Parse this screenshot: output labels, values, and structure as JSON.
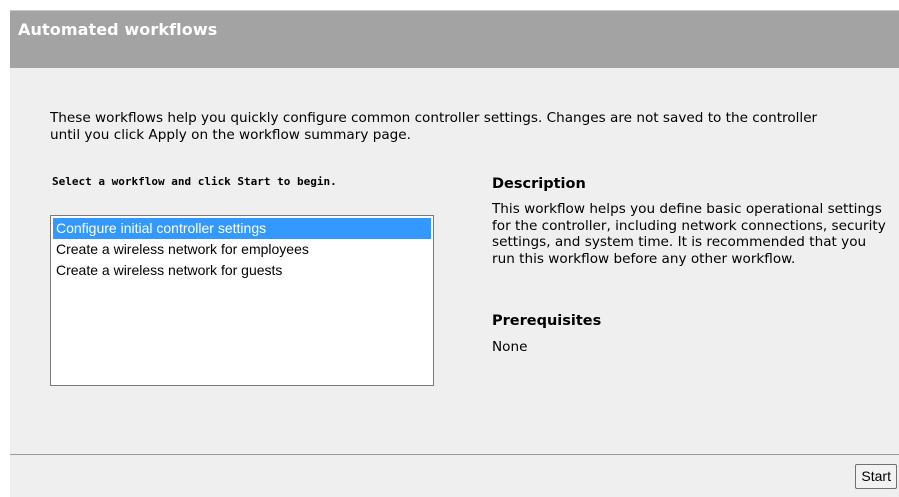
{
  "window": {
    "title": "Automated workflows"
  },
  "intro": {
    "text": "These workflows help you quickly configure common controller settings. Changes are not saved to the controller until you click Apply on the workflow summary page."
  },
  "workflow_list": {
    "label": "Select a workflow and click Start to begin.",
    "items": [
      "Configure initial controller settings",
      "Create a wireless network for employees",
      "Create a wireless network for guests"
    ],
    "selected": "Configure initial controller settings"
  },
  "description": {
    "heading": "Description",
    "text": "This workflow helps you define basic operational settings for the controller, including network connections, security settings, and system time. It is recommended that you run this workflow before any other workflow."
  },
  "prerequisites": {
    "heading": "Prerequisites",
    "text": "None"
  },
  "footer": {
    "start_label": "Start"
  },
  "colors": {
    "title_bar": "#a3a3a3",
    "content_bg": "#efefef",
    "selection": "#3399ff"
  }
}
